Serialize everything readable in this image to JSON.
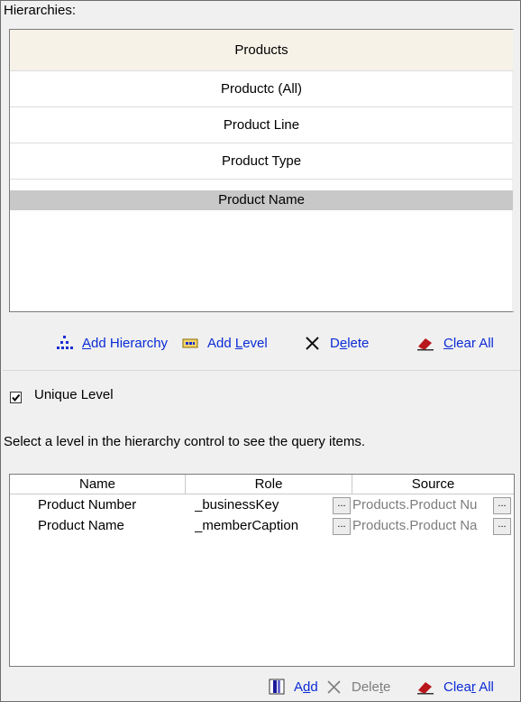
{
  "hierarchies": {
    "label": "Hierarchies:",
    "header": "Products",
    "levels": [
      "Productc (All)",
      "Product Line",
      "Product Type",
      "Product Name"
    ]
  },
  "toolbar": {
    "add_hierarchy": {
      "pre": "",
      "u": "A",
      "post": "dd Hierarchy"
    },
    "add_level": {
      "pre": "Add ",
      "u": "L",
      "post": "evel"
    },
    "delete": {
      "pre": "D",
      "u": "e",
      "post": "lete"
    },
    "clear_all": {
      "pre": "",
      "u": "C",
      "post": "lear All"
    }
  },
  "unique_level": {
    "label": "Unique Level",
    "checked": true
  },
  "hint": "Select a level in the hierarchy control to see the query items.",
  "grid": {
    "columns": [
      "Name",
      "Role",
      "Source"
    ],
    "rows": [
      {
        "name": "Product Number",
        "role": "_businessKey",
        "source": "Products.Product Nu"
      },
      {
        "name": "Product Name",
        "role": "_memberCaption",
        "source": "Products.Product Na"
      }
    ],
    "ellipsis": "..."
  },
  "bottom_toolbar": {
    "add": {
      "pre": "A",
      "u": "d",
      "post": "d"
    },
    "delete": {
      "pre": "Dele",
      "u": "t",
      "post": "e"
    },
    "clear_all": {
      "pre": "Clea",
      "u": "r",
      "post": " All"
    }
  },
  "colors": {
    "link": "#0a2bd6",
    "selected_row": "#c8c8c8",
    "header_row": "#f6f2e7"
  }
}
